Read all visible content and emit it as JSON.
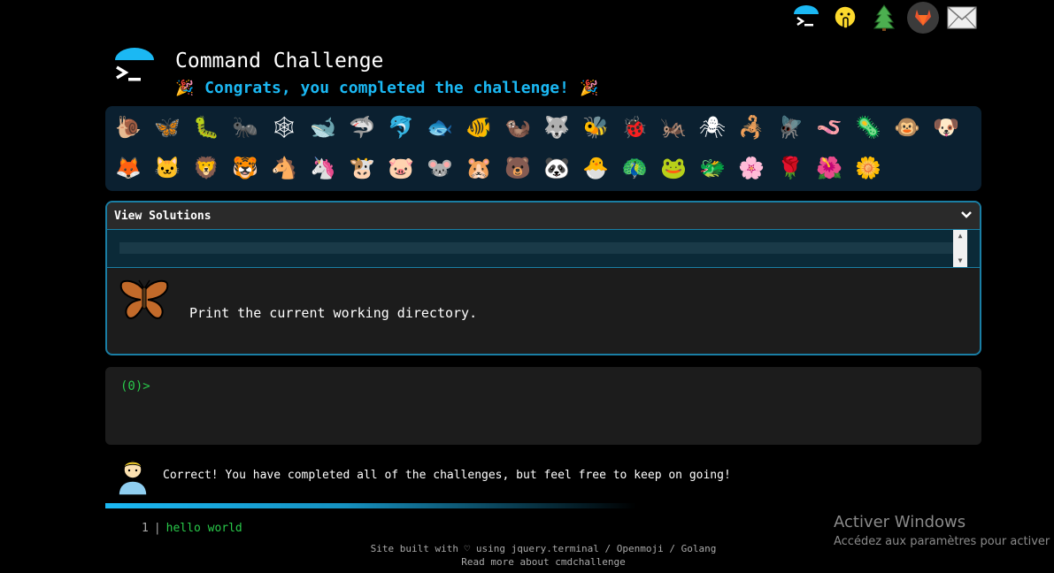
{
  "header": {
    "title": "Command Challenge",
    "congrats": "Congrats, you completed the challenge!",
    "party_emoji": "🎉"
  },
  "top_links": [
    {
      "name": "cmdchallenge-icon"
    },
    {
      "name": "shush-emoji-icon"
    },
    {
      "name": "tree-icon"
    },
    {
      "name": "gitlab-icon"
    },
    {
      "name": "mail-icon"
    }
  ],
  "emoji_rows": [
    [
      "🐌",
      "🦋",
      "🐛",
      "🐜",
      "🕸",
      "🐋",
      "🦈",
      "🐬",
      "🐟",
      "🐠",
      "🦦",
      "🐺",
      "🐝",
      "🐞",
      "🦗",
      "🕷",
      "🦂",
      "🪰",
      "🪱",
      "🦠",
      "🐵",
      "🐶"
    ],
    [
      "🦊",
      "🐱",
      "🦁",
      "🐯",
      "🐴",
      "🦄",
      "🐮",
      "🐷",
      "🐭",
      "🐹",
      "🐻",
      "🐼",
      "🐣",
      "🦚",
      "🐸",
      "🐲",
      "🌸",
      "🌹",
      "🌺",
      "🌼"
    ]
  ],
  "solutions": {
    "header": "View Solutions",
    "task": "Print the current working directory."
  },
  "terminal": {
    "prompt": "(0)>"
  },
  "result": {
    "message": "Correct! You have completed all of the challenges, but feel free to keep on going!"
  },
  "history": {
    "line_number": "1",
    "separator": "|",
    "command": "hello world"
  },
  "footer": {
    "line1": "Site built with ♡ using jquery.terminal / Openmoji / Golang",
    "line2": "Read more about cmdchallenge"
  },
  "windows_watermark": {
    "title": "Activer Windows",
    "subtitle": "Accédez aux paramètres pour activer"
  },
  "colors": {
    "accent": "#1bb8f3",
    "panel_border": "#1a7ea4",
    "prompt_green": "#29c94a",
    "emoji_panel_bg": "#0b2030"
  }
}
